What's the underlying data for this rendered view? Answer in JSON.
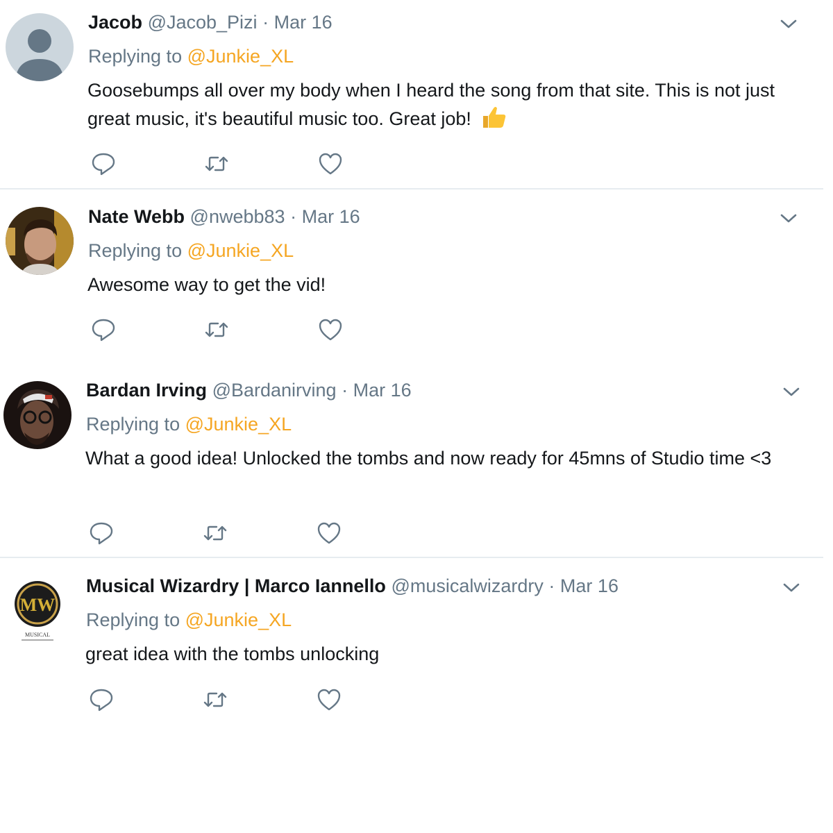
{
  "tweets": [
    {
      "name": "Jacob",
      "handle": "@Jacob_Pizi",
      "separator": "·",
      "date": "Mar 16",
      "replying_prefix": "Replying to",
      "replying_to": "@Junkie_XL",
      "text": "Goosebumps all over my body when I heard the song from that site. This is not just great music, it's beautiful music too. Great job!",
      "emoji": "thumbs-up-icon"
    },
    {
      "name": "Nate Webb",
      "handle": "@nwebb83",
      "separator": "·",
      "date": "Mar 16",
      "replying_prefix": "Replying to",
      "replying_to": "@Junkie_XL",
      "text": "Awesome way to get the vid!"
    },
    {
      "name": "Bardan Irving",
      "handle": "@Bardanirving",
      "separator": "·",
      "date": "Mar 16",
      "replying_prefix": "Replying to",
      "replying_to": "@Junkie_XL",
      "text": "What a good idea! Unlocked the tombs and now ready for 45mns of Studio time <3"
    },
    {
      "name": "Musical Wizardry | Marco Iannello",
      "handle": "@musicalwizardry",
      "separator": "·",
      "date": "Mar 16",
      "replying_prefix": "Replying to",
      "replying_to": "@Junkie_XL",
      "text": "great idea with the tombs unlocking",
      "avatar_logo_text": "MW",
      "avatar_caption": "MUSICAL"
    }
  ],
  "icons": {
    "reply": "reply-icon",
    "retweet": "retweet-icon",
    "like": "like-icon",
    "menu": "chevron-down-icon"
  },
  "colors": {
    "mention": "#f5a623",
    "secondary_text": "#657786",
    "primary_text": "#14171a",
    "divider": "#e6ecf0"
  }
}
